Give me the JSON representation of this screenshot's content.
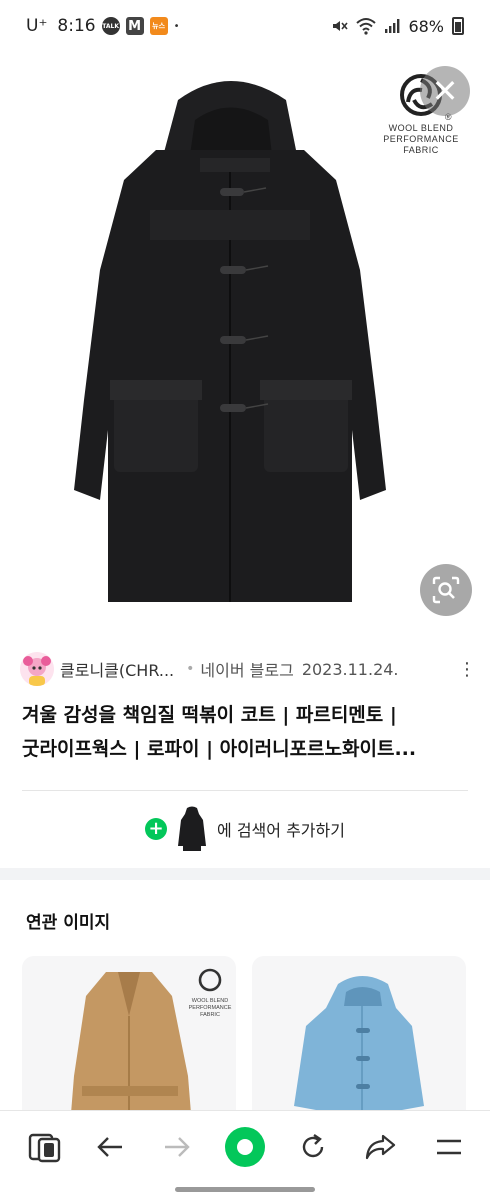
{
  "status_bar": {
    "carrier": "U⁺",
    "time": "8:16",
    "icons": [
      "talk-icon",
      "gmail-icon",
      "news-icon",
      "dot"
    ],
    "talk_label": "TALK",
    "gmail_label": "M",
    "news_label": "뉴스",
    "dot": "•",
    "battery": "68%"
  },
  "hero": {
    "brand_logo_lines": [
      "WOOL BLEND",
      "PERFORMANCE",
      "FABRIC"
    ],
    "registered_mark": "®",
    "close_icon": "✕"
  },
  "source": {
    "name": "클로니클(CHR...",
    "separator": "•",
    "type": "네이버 블로그",
    "date": "2023.11.24.",
    "more": "⋮"
  },
  "title_lines": [
    "겨울 감성을 책임질 떡볶이 코트 | 파르티멘토 |",
    "굿라이프웍스 | 로파이 | 아이러니포르노화이트..."
  ],
  "add_search": {
    "plus": "+",
    "label": "에 검색어 추가하기"
  },
  "related": {
    "title": "연관 이미지"
  },
  "colors": {
    "accent": "#03c75a",
    "coat_black": "#1c1c1e",
    "coat_blue": "#7fb4d8",
    "coat_camel": "#c49863"
  }
}
